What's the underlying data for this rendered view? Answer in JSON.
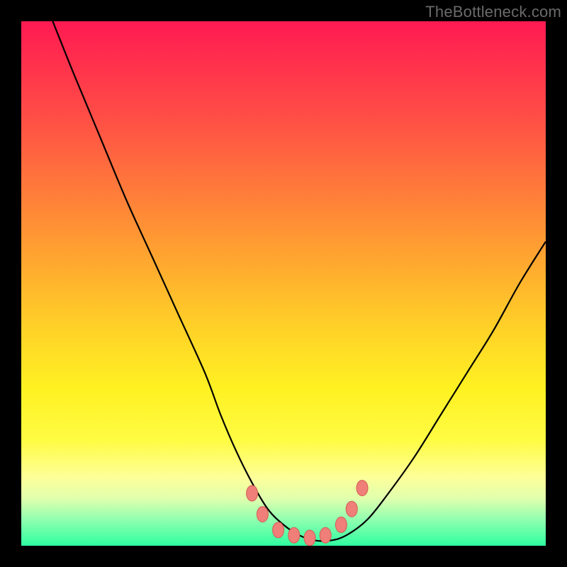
{
  "watermark": {
    "text": "TheBottleneck.com"
  },
  "colors": {
    "curve_stroke": "#000000",
    "marker_fill": "#ef7f78",
    "marker_stroke": "#d45c54",
    "frame": "#000000"
  },
  "chart_data": {
    "type": "line",
    "title": "",
    "xlabel": "",
    "ylabel": "",
    "xlim": [
      0,
      100
    ],
    "ylim": [
      0,
      100
    ],
    "grid": false,
    "x": [
      6,
      10,
      15,
      20,
      25,
      30,
      35,
      38,
      41,
      44,
      47,
      50,
      53,
      56,
      59,
      62,
      66,
      70,
      75,
      80,
      85,
      90,
      95,
      100
    ],
    "y": [
      100,
      90,
      78,
      66,
      55,
      44,
      33,
      25,
      18,
      12,
      7,
      4,
      2,
      1,
      1,
      2,
      5,
      10,
      17,
      25,
      33,
      41,
      50,
      58
    ],
    "markers": {
      "x": [
        44,
        46,
        49,
        52,
        55,
        58,
        61,
        63,
        65
      ],
      "y": [
        10,
        6,
        3,
        2,
        1.5,
        2,
        4,
        7,
        11
      ]
    }
  }
}
